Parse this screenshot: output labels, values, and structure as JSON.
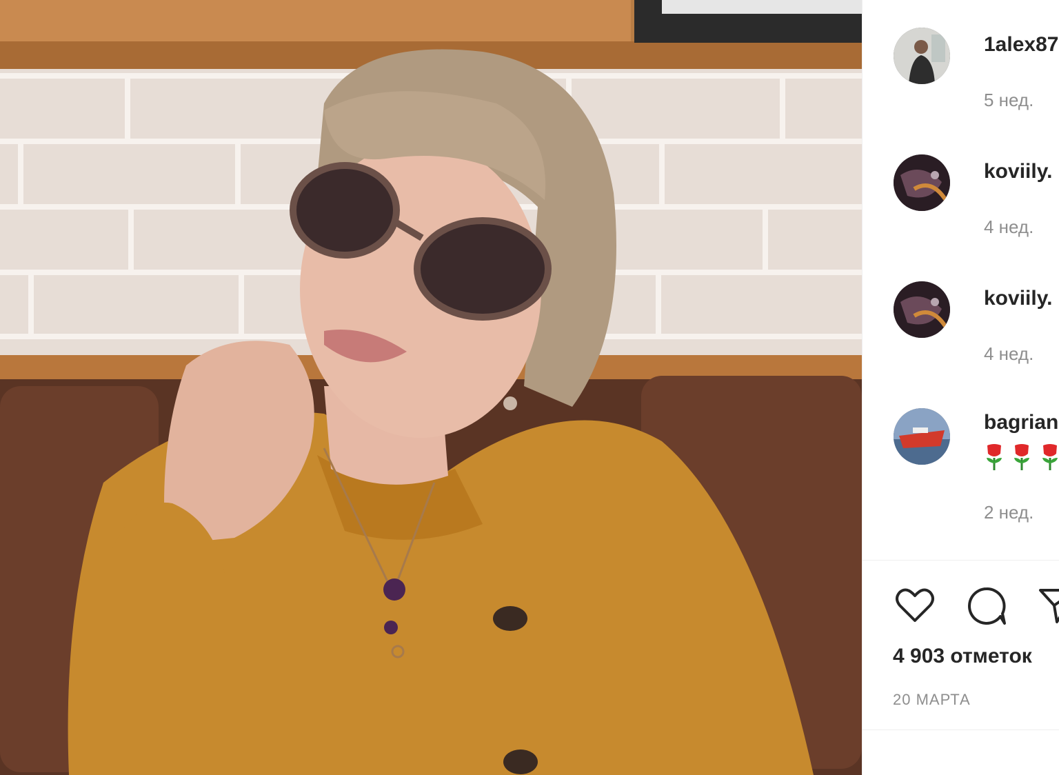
{
  "post": {
    "comments": [
      {
        "username": "1alex87",
        "time": "5 нед.",
        "avatar": "avatar-man"
      },
      {
        "username": "koviily.",
        "time": "4 нед.",
        "avatar": "avatar-dark"
      },
      {
        "username": "koviily.",
        "time": "4 нед.",
        "avatar": "avatar-dark"
      },
      {
        "username": "bagrian",
        "time": "2 нед.",
        "avatar": "avatar-boat",
        "emoji": "🌹🌹🌹🌹"
      }
    ],
    "actions": {
      "like_icon": "heart-icon",
      "comment_icon": "comment-bubble-icon",
      "share_icon": "share-paper-plane-icon"
    },
    "likes": "4 903 отметок",
    "date": "20 МАРТА"
  },
  "colors": {
    "text": "#262626",
    "secondary": "#8e8e8e",
    "divider": "#efefef",
    "rose": "#e0282a"
  }
}
